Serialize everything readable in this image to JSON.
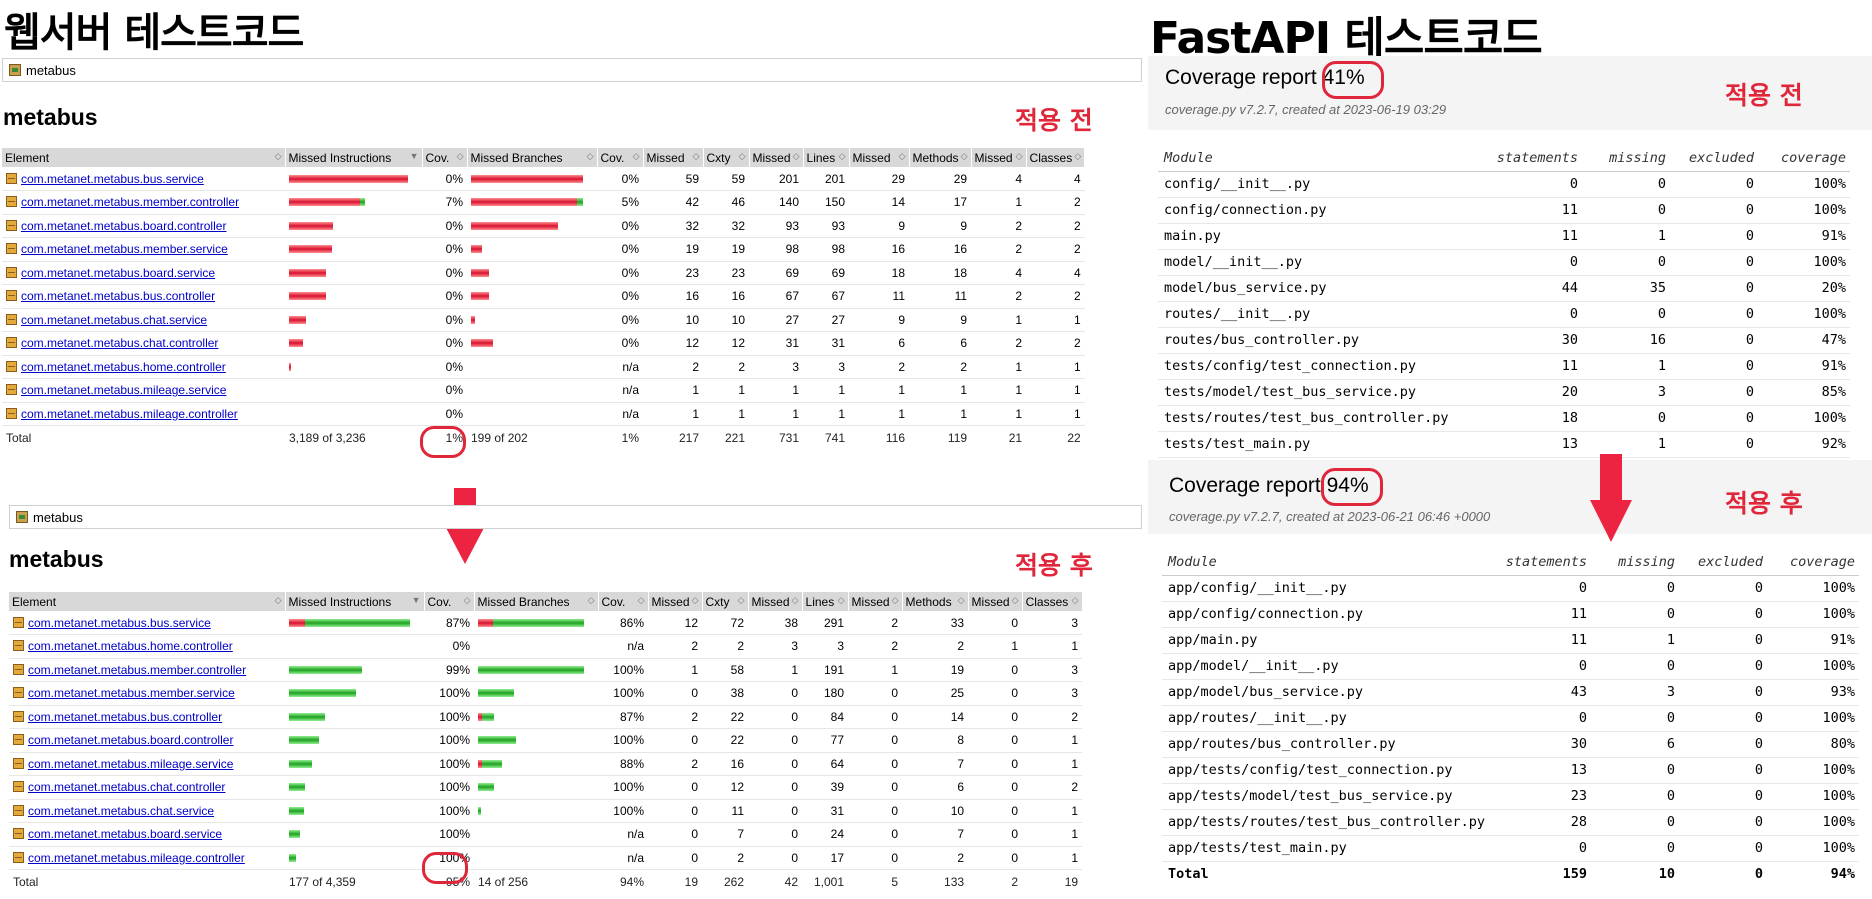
{
  "left_title": "웹서버 테스트코드",
  "right_title": "FastAPI 테스트코드",
  "before_label": "적용 전",
  "after_label": "적용 후",
  "jacoco_before": {
    "breadcrumb": "metabus",
    "heading": "metabus",
    "headers": [
      "Element",
      "Missed Instructions",
      "Cov.",
      "Missed Branches",
      "Cov.",
      "Missed",
      "Cxty",
      "Missed",
      "Lines",
      "Missed",
      "Methods",
      "Missed",
      "Classes"
    ],
    "rows": [
      {
        "name": "com.metanet.metabus.bus.service",
        "instr_miss": 1.0,
        "instr_cov": "0%",
        "br_miss": 1.0,
        "br_cov": "0%",
        "c1": "59",
        "c2": "59",
        "c3": "201",
        "c4": "201",
        "c5": "29",
        "c6": "29",
        "c7": "4",
        "c8": "4"
      },
      {
        "name": "com.metanet.metabus.member.controller",
        "instr_miss": 0.6,
        "instr_hit": 0.04,
        "instr_cov": "7%",
        "br_miss": 0.95,
        "br_hit": 0.05,
        "br_cov": "5%",
        "c1": "42",
        "c2": "46",
        "c3": "140",
        "c4": "150",
        "c5": "14",
        "c6": "17",
        "c7": "1",
        "c8": "2"
      },
      {
        "name": "com.metanet.metabus.board.controller",
        "instr_miss": 0.37,
        "instr_cov": "0%",
        "br_miss": 0.78,
        "br_cov": "0%",
        "c1": "32",
        "c2": "32",
        "c3": "93",
        "c4": "93",
        "c5": "9",
        "c6": "9",
        "c7": "2",
        "c8": "2"
      },
      {
        "name": "com.metanet.metabus.member.service",
        "instr_miss": 0.36,
        "instr_cov": "0%",
        "br_miss": 0.1,
        "br_cov": "0%",
        "c1": "19",
        "c2": "19",
        "c3": "98",
        "c4": "98",
        "c5": "16",
        "c6": "16",
        "c7": "2",
        "c8": "2"
      },
      {
        "name": "com.metanet.metabus.board.service",
        "instr_miss": 0.31,
        "instr_cov": "0%",
        "br_miss": 0.16,
        "br_cov": "0%",
        "c1": "23",
        "c2": "23",
        "c3": "69",
        "c4": "69",
        "c5": "18",
        "c6": "18",
        "c7": "4",
        "c8": "4"
      },
      {
        "name": "com.metanet.metabus.bus.controller",
        "instr_miss": 0.31,
        "instr_cov": "0%",
        "br_miss": 0.16,
        "br_cov": "0%",
        "c1": "16",
        "c2": "16",
        "c3": "67",
        "c4": "67",
        "c5": "11",
        "c6": "11",
        "c7": "2",
        "c8": "2"
      },
      {
        "name": "com.metanet.metabus.chat.service",
        "instr_miss": 0.14,
        "instr_cov": "0%",
        "br_miss": 0.04,
        "br_cov": "0%",
        "c1": "10",
        "c2": "10",
        "c3": "27",
        "c4": "27",
        "c5": "9",
        "c6": "9",
        "c7": "1",
        "c8": "1"
      },
      {
        "name": "com.metanet.metabus.chat.controller",
        "instr_miss": 0.12,
        "instr_cov": "0%",
        "br_miss": 0.2,
        "br_cov": "0%",
        "c1": "12",
        "c2": "12",
        "c3": "31",
        "c4": "31",
        "c5": "6",
        "c6": "6",
        "c7": "2",
        "c8": "2"
      },
      {
        "name": "com.metanet.metabus.home.controller",
        "instr_miss": 0.02,
        "instr_cov": "0%",
        "br_miss": 0,
        "br_cov": "n/a",
        "c1": "2",
        "c2": "2",
        "c3": "3",
        "c4": "3",
        "c5": "2",
        "c6": "2",
        "c7": "1",
        "c8": "1"
      },
      {
        "name": "com.metanet.metabus.mileage.service",
        "instr_miss": 0,
        "instr_cov": "0%",
        "br_miss": 0,
        "br_cov": "n/a",
        "c1": "1",
        "c2": "1",
        "c3": "1",
        "c4": "1",
        "c5": "1",
        "c6": "1",
        "c7": "1",
        "c8": "1"
      },
      {
        "name": "com.metanet.metabus.mileage.controller",
        "instr_miss": 0,
        "instr_cov": "0%",
        "br_miss": 0,
        "br_cov": "n/a",
        "c1": "1",
        "c2": "1",
        "c3": "1",
        "c4": "1",
        "c5": "1",
        "c6": "1",
        "c7": "1",
        "c8": "1"
      }
    ],
    "total": {
      "label": "Total",
      "instr": "3,189 of 3,236",
      "instr_cov": "1%",
      "br": "199 of 202",
      "br_cov": "1%",
      "c1": "217",
      "c2": "221",
      "c3": "731",
      "c4": "741",
      "c5": "116",
      "c6": "119",
      "c7": "21",
      "c8": "22"
    }
  },
  "jacoco_after": {
    "breadcrumb": "metabus",
    "heading": "metabus",
    "headers": [
      "Element",
      "Missed Instructions",
      "Cov.",
      "Missed Branches",
      "Cov.",
      "Missed",
      "Cxty",
      "Missed",
      "Lines",
      "Missed",
      "Methods",
      "Missed",
      "Classes"
    ],
    "rows": [
      {
        "name": "com.metanet.metabus.bus.service",
        "instr_miss": 0.13,
        "instr_hit": 0.87,
        "instr_cov": "87%",
        "br_miss": 0.14,
        "br_hit": 0.86,
        "br_cov": "86%",
        "c1": "12",
        "c2": "72",
        "c3": "38",
        "c4": "291",
        "c5": "2",
        "c6": "33",
        "c7": "0",
        "c8": "3"
      },
      {
        "name": "com.metanet.metabus.home.controller",
        "instr_miss": 0,
        "instr_hit": 0,
        "instr_cov": "0%",
        "br_miss": 0,
        "br_hit": 0,
        "br_cov": "n/a",
        "c1": "2",
        "c2": "2",
        "c3": "3",
        "c4": "3",
        "c5": "2",
        "c6": "2",
        "c7": "1",
        "c8": "1"
      },
      {
        "name": "com.metanet.metabus.member.controller",
        "instr_miss": 0,
        "instr_hit": 0.6,
        "instr_cov": "99%",
        "br_miss": 0,
        "br_hit": 1.0,
        "br_cov": "100%",
        "c1": "1",
        "c2": "58",
        "c3": "1",
        "c4": "191",
        "c5": "1",
        "c6": "19",
        "c7": "0",
        "c8": "3"
      },
      {
        "name": "com.metanet.metabus.member.service",
        "instr_miss": 0,
        "instr_hit": 0.55,
        "instr_cov": "100%",
        "br_miss": 0,
        "br_hit": 0.34,
        "br_cov": "100%",
        "c1": "0",
        "c2": "38",
        "c3": "0",
        "c4": "180",
        "c5": "0",
        "c6": "25",
        "c7": "0",
        "c8": "3"
      },
      {
        "name": "com.metanet.metabus.bus.controller",
        "instr_miss": 0,
        "instr_hit": 0.3,
        "instr_cov": "100%",
        "br_miss": 0.04,
        "br_hit": 0.11,
        "br_cov": "87%",
        "c1": "2",
        "c2": "22",
        "c3": "0",
        "c4": "84",
        "c5": "0",
        "c6": "14",
        "c7": "0",
        "c8": "2"
      },
      {
        "name": "com.metanet.metabus.board.controller",
        "instr_miss": 0,
        "instr_hit": 0.25,
        "instr_cov": "100%",
        "br_miss": 0,
        "br_hit": 0.36,
        "br_cov": "100%",
        "c1": "0",
        "c2": "22",
        "c3": "0",
        "c4": "77",
        "c5": "0",
        "c6": "8",
        "c7": "0",
        "c8": "1"
      },
      {
        "name": "com.metanet.metabus.mileage.service",
        "instr_miss": 0,
        "instr_hit": 0.19,
        "instr_cov": "100%",
        "br_miss": 0.04,
        "br_hit": 0.19,
        "br_cov": "88%",
        "c1": "2",
        "c2": "16",
        "c3": "0",
        "c4": "64",
        "c5": "0",
        "c6": "7",
        "c7": "0",
        "c8": "1"
      },
      {
        "name": "com.metanet.metabus.chat.controller",
        "instr_miss": 0,
        "instr_hit": 0.13,
        "instr_cov": "100%",
        "br_miss": 0,
        "br_hit": 0.15,
        "br_cov": "100%",
        "c1": "0",
        "c2": "12",
        "c3": "0",
        "c4": "39",
        "c5": "0",
        "c6": "6",
        "c7": "0",
        "c8": "2"
      },
      {
        "name": "com.metanet.metabus.chat.service",
        "instr_miss": 0,
        "instr_hit": 0.12,
        "instr_cov": "100%",
        "br_miss": 0,
        "br_hit": 0.03,
        "br_cov": "100%",
        "c1": "0",
        "c2": "11",
        "c3": "0",
        "c4": "31",
        "c5": "0",
        "c6": "10",
        "c7": "0",
        "c8": "1"
      },
      {
        "name": "com.metanet.metabus.board.service",
        "instr_miss": 0,
        "instr_hit": 0.09,
        "instr_cov": "100%",
        "br_miss": 0,
        "br_hit": 0,
        "br_cov": "n/a",
        "c1": "0",
        "c2": "7",
        "c3": "0",
        "c4": "24",
        "c5": "0",
        "c6": "7",
        "c7": "0",
        "c8": "1"
      },
      {
        "name": "com.metanet.metabus.mileage.controller",
        "instr_miss": 0,
        "instr_hit": 0.06,
        "instr_cov": "100%",
        "br_miss": 0,
        "br_hit": 0,
        "br_cov": "n/a",
        "c1": "0",
        "c2": "2",
        "c3": "0",
        "c4": "17",
        "c5": "0",
        "c6": "2",
        "c7": "0",
        "c8": "1"
      }
    ],
    "total": {
      "label": "Total",
      "instr": "177 of 4,359",
      "instr_cov": "95%",
      "br": "14 of 256",
      "br_cov": "94%",
      "c1": "19",
      "c2": "262",
      "c3": "42",
      "c4": "1,001",
      "c5": "5",
      "c6": "133",
      "c7": "2",
      "c8": "19"
    }
  },
  "cov_before": {
    "title": "Coverage report",
    "pct": "41%",
    "meta": "coverage.py v7.2.7, created at 2023-06-19 03:29",
    "headers": [
      "Module",
      "statements",
      "missing",
      "excluded",
      "coverage"
    ],
    "rows": [
      [
        "config/__init__.py",
        "0",
        "0",
        "0",
        "100%"
      ],
      [
        "config/connection.py",
        "11",
        "0",
        "0",
        "100%"
      ],
      [
        "main.py",
        "11",
        "1",
        "0",
        "91%"
      ],
      [
        "model/__init__.py",
        "0",
        "0",
        "0",
        "100%"
      ],
      [
        "model/bus_service.py",
        "44",
        "35",
        "0",
        "20%"
      ],
      [
        "routes/__init__.py",
        "0",
        "0",
        "0",
        "100%"
      ],
      [
        "routes/bus_controller.py",
        "30",
        "16",
        "0",
        "47%"
      ],
      [
        "tests/config/test_connection.py",
        "11",
        "1",
        "0",
        "91%"
      ],
      [
        "tests/model/test_bus_service.py",
        "20",
        "3",
        "0",
        "85%"
      ],
      [
        "tests/routes/test_bus_controller.py",
        "18",
        "0",
        "0",
        "100%"
      ],
      [
        "tests/test_main.py",
        "13",
        "1",
        "0",
        "92%"
      ]
    ]
  },
  "cov_after": {
    "title": "Coverage report",
    "pct": "94%",
    "meta": "coverage.py v7.2.7, created at 2023-06-21 06:46 +0000",
    "headers": [
      "Module",
      "statements",
      "missing",
      "excluded",
      "coverage"
    ],
    "rows": [
      [
        "app/config/__init__.py",
        "0",
        "0",
        "0",
        "100%"
      ],
      [
        "app/config/connection.py",
        "11",
        "0",
        "0",
        "100%"
      ],
      [
        "app/main.py",
        "11",
        "1",
        "0",
        "91%"
      ],
      [
        "app/model/__init__.py",
        "0",
        "0",
        "0",
        "100%"
      ],
      [
        "app/model/bus_service.py",
        "43",
        "3",
        "0",
        "93%"
      ],
      [
        "app/routes/__init__.py",
        "0",
        "0",
        "0",
        "100%"
      ],
      [
        "app/routes/bus_controller.py",
        "30",
        "6",
        "0",
        "80%"
      ],
      [
        "app/tests/config/test_connection.py",
        "13",
        "0",
        "0",
        "100%"
      ],
      [
        "app/tests/model/test_bus_service.py",
        "23",
        "0",
        "0",
        "100%"
      ],
      [
        "app/tests/routes/test_bus_controller.py",
        "28",
        "0",
        "0",
        "100%"
      ],
      [
        "app/tests/test_main.py",
        "0",
        "0",
        "0",
        "100%"
      ]
    ],
    "total": [
      "Total",
      "159",
      "10",
      "0",
      "94%"
    ]
  },
  "colors": {
    "highlight": "#e0263a",
    "miss": "#d8102f",
    "hit": "#20a020"
  }
}
